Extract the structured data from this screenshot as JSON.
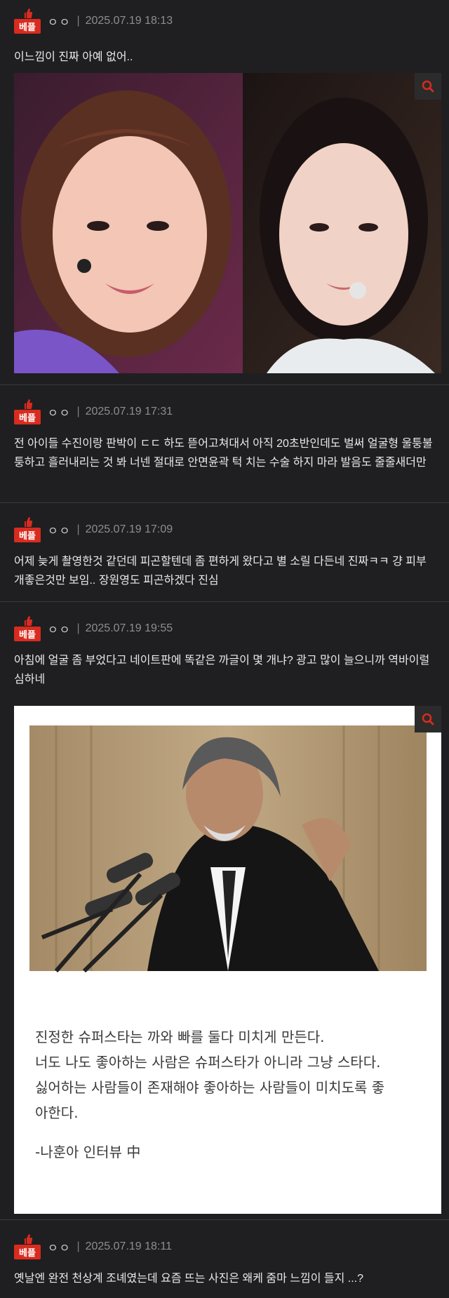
{
  "comments": [
    {
      "badge": "베플",
      "author": "ㅇㅇ",
      "date": "2025.07.19 18:13",
      "text": "이느낌이 진짜 아예 없어.."
    },
    {
      "badge": "베플",
      "author": "ㅇㅇ",
      "date": "2025.07.19 17:31",
      "text": "전 아이들 수진이랑 판박이 ㄷㄷ 하도 뜯어고쳐대서 아직 20초반인데도 벌써 얼굴형 울퉁불퉁하고 흘러내리는 것 봐 너넨 절대로 안면윤곽 턱 치는 수술 하지 마라 발음도 줄줄새더만"
    },
    {
      "badge": "베플",
      "author": "ㅇㅇ",
      "date": "2025.07.19 17:09",
      "text": "어제 늦게 촬영한것 같던데 피곤할텐데 좀 편하게 왔다고 별 소릴 다든네 진짜ㅋㅋ 걍 피부 개좋은것만 보임.. 장원영도 피곤하겠다 진심"
    },
    {
      "badge": "베플",
      "author": "ㅇㅇ",
      "date": "2025.07.19 19:55",
      "text": "아침에 얼굴 좀 부었다고 네이트판에 똑같은 까글이 몇 개냐? 광고 많이 늘으니까 역바이럴 심하네"
    },
    {
      "badge": "베플",
      "author": "ㅇㅇ",
      "date": "2025.07.19 18:11",
      "text": "옛날엔 완전 천상계 조녜였는데 요즘 뜨는 사진은 왜케 줌마 느낌이 들지 ...?"
    }
  ],
  "quote_image": {
    "lines": [
      "진정한 슈퍼스타는 까와 빠를 둘다 미치게 만든다.",
      "너도 나도 좋아하는 사람은 슈퍼스타가 아니라 그냥 스타다.",
      "싫어하는 사람들이 존재해야 좋아하는 사람들이 미치도록 좋",
      "아한다."
    ],
    "attribution": "-나훈아 인터뷰 中"
  },
  "colors": {
    "background": "#1f1f21",
    "badge": "#d92b1f",
    "zoom_icon": "#d92b1f"
  },
  "icons": {
    "badge": "thumbs-up-icon",
    "image_action": "search-icon"
  }
}
